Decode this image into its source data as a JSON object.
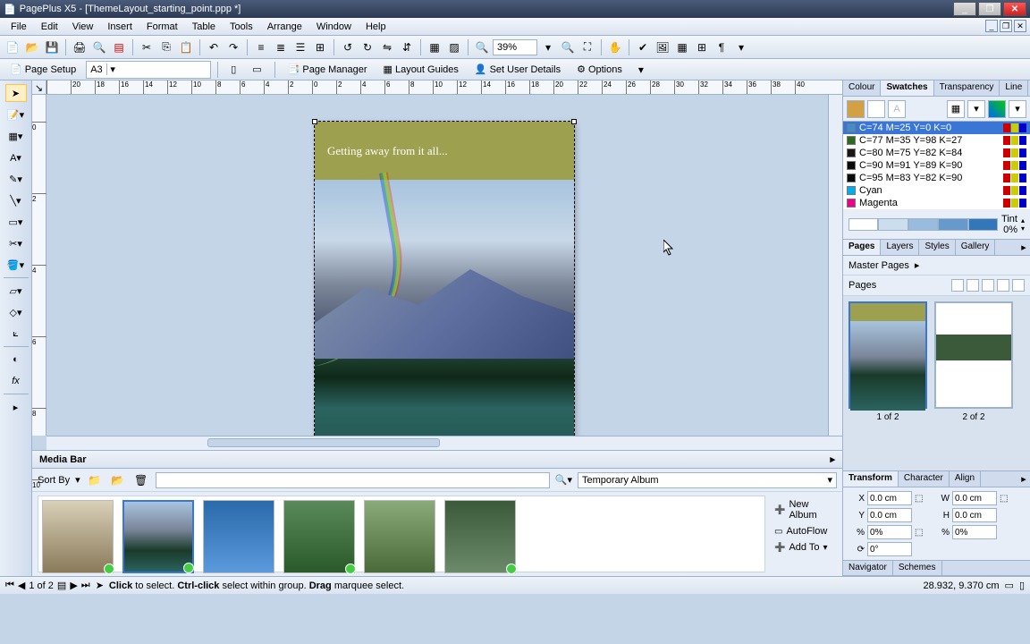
{
  "app": {
    "title": "PagePlus X5 - [ThemeLayout_starting_point.ppp *]"
  },
  "menu": [
    "File",
    "Edit",
    "View",
    "Insert",
    "Format",
    "Table",
    "Tools",
    "Arrange",
    "Window",
    "Help"
  ],
  "zoom": "39%",
  "toolbar2": {
    "page_setup": "Page Setup",
    "paper": "A3",
    "page_manager": "Page Manager",
    "layout_guides": "Layout Guides",
    "user_details": "Set User Details",
    "options": "Options"
  },
  "ruler_h": [
    "",
    "20",
    "18",
    "16",
    "14",
    "12",
    "10",
    "8",
    "6",
    "4",
    "2",
    "0",
    "2",
    "4",
    "6",
    "8",
    "10",
    "12",
    "14",
    "16",
    "18",
    "20",
    "22",
    "24",
    "26",
    "28",
    "30",
    "32",
    "34",
    "36",
    "38",
    "40"
  ],
  "ruler_v": [
    "0",
    "2",
    "4",
    "6",
    "8",
    "10"
  ],
  "page_text": "Getting away from it all...",
  "swatches_panel": {
    "tabs": [
      "Colour",
      "Swatches",
      "Transparency",
      "Line"
    ],
    "active": 1,
    "items": [
      {
        "name": "C=74 M=25 Y=0 K=0",
        "color": "#3f8ecf",
        "sel": true
      },
      {
        "name": "C=77 M=35 Y=98 K=27",
        "color": "#2f6a1e"
      },
      {
        "name": "C=80 M=75 Y=82 K=84",
        "color": "#1a1716"
      },
      {
        "name": "C=90 M=91 Y=89 K=90",
        "color": "#0a0809"
      },
      {
        "name": "C=95 M=83 Y=82 K=90",
        "color": "#050a0b"
      },
      {
        "name": "Cyan",
        "color": "#00aeef"
      },
      {
        "name": "Magenta",
        "color": "#ec008c"
      }
    ],
    "tint_label": "Tint",
    "tint_value": "0%"
  },
  "pages_panel": {
    "tabs": [
      "Pages",
      "Layers",
      "Styles",
      "Gallery"
    ],
    "master": "Master Pages",
    "pages_label": "Pages",
    "page1": "1 of 2",
    "page2": "2 of 2"
  },
  "transform": {
    "tabs": [
      "Transform",
      "Character",
      "Align"
    ],
    "x": "0.0 cm",
    "y": "0.0 cm",
    "w": "0.0 cm",
    "h": "0.0 cm",
    "sx": "0%",
    "sy": "0%",
    "r": "0°"
  },
  "nav_tabs": [
    "Navigator",
    "Schemes"
  ],
  "media": {
    "title": "Media Bar",
    "sort_by": "Sort By",
    "album": "Temporary Album",
    "new_album": "New Album",
    "autoflow": "AutoFlow",
    "add_to": "Add To"
  },
  "status": {
    "page": "1 of 2",
    "hint_click": "Click",
    "hint_click_t": " to select. ",
    "hint_ctrl": "Ctrl-click",
    "hint_ctrl_t": " select within group. ",
    "hint_drag": "Drag",
    "hint_drag_t": " marquee select.",
    "coords": "28.932,  9.370 cm"
  }
}
